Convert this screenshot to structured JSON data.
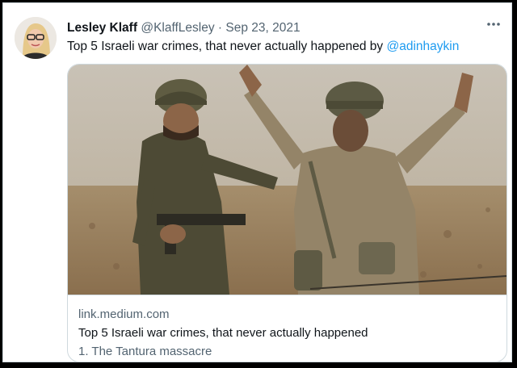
{
  "tweet": {
    "author_name": "Lesley Klaff",
    "author_handle": "@KlaffLesley",
    "separator": "·",
    "date": "Sep 23, 2021",
    "more_icon": "more-icon",
    "text_before_mention": "Top 5 Israeli war crimes, that never actually happened by ",
    "mention": "@adinhaykin"
  },
  "card": {
    "domain": "link.medium.com",
    "title": "Top 5 Israeli war crimes, that never actually happened",
    "description": "1. The Tantura massacre"
  },
  "colors": {
    "text_primary": "#0f1419",
    "text_secondary": "#536471",
    "link": "#1d9bf0",
    "border": "#cfd9de"
  }
}
